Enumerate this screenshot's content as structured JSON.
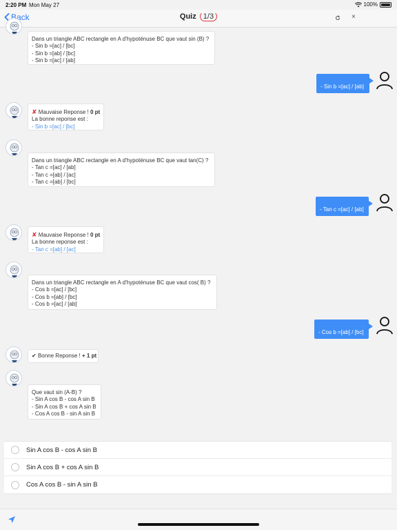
{
  "status": {
    "time": "2:20 PM",
    "date": "Mon May 27",
    "battery": "100%"
  },
  "nav": {
    "back_label": "Back",
    "title": "Quiz",
    "count": "1/3",
    "close": "×"
  },
  "messages": [
    {
      "from": "bot",
      "kind": "question",
      "lines": [
        "Dans un triangle ABC rectangle en A d'hypoténuse BC que vaut sin (B) ?",
        "- Sin b =[ac] / [bc]",
        "- Sin b =[ab] / [bc]",
        "- Sin b =[ac] / [ab]"
      ]
    },
    {
      "from": "user",
      "text": "- Sin b =[ac] / [ab]"
    },
    {
      "from": "bot",
      "kind": "feedback",
      "mark": "✘",
      "status": "Mauvaise Reponse !",
      "points": "0 pt",
      "line2": "La bonne reponse est :",
      "answer": "- Sin b =[ac] / [bc]"
    },
    {
      "from": "bot",
      "kind": "question",
      "lines": [
        "Dans un triangle ABC rectangle en A d'hypoténuse BC que vaut tan(C) ?",
        "- Tan c =[ac] / [ab]",
        "- Tan c =[ab] / [ac]",
        "- Tan c =[ab] / [bc]"
      ]
    },
    {
      "from": "user",
      "text": "- Tan c =[ac] / [ab]"
    },
    {
      "from": "bot",
      "kind": "feedback",
      "mark": "✘",
      "status": "Mauvaise Reponse !",
      "points": "0 pt",
      "line2": "La bonne reponse est :",
      "answer": "- Tan c =[ab] / [ac]"
    },
    {
      "from": "bot",
      "kind": "question",
      "lines": [
        "Dans un triangle ABC rectangle en A d'hypoténuse BC que vaut cos( B) ?",
        "- Cos b =[ac] / [bc]",
        "- Cos b =[ab] / [bc]",
        "- Cos b =[ac] / [ab]"
      ]
    },
    {
      "from": "user",
      "text": "- Cos b =[ab] / [bc]"
    },
    {
      "from": "bot",
      "kind": "result",
      "mark": "✔",
      "status": "Bonne Reponse !",
      "points": "+ 1 pt"
    },
    {
      "from": "bot",
      "kind": "question",
      "lines": [
        "Que vaut sin (A-B) ?",
        "- Sin A cos B - cos A sin B",
        "- Sin A cos B + cos A sin B",
        "- Cos A cos B - sin A sin B"
      ]
    }
  ],
  "choices": [
    "Sin A cos B - cos A sin B",
    "Sin A cos B + cos A sin B",
    "Cos A cos B - sin A sin B"
  ]
}
